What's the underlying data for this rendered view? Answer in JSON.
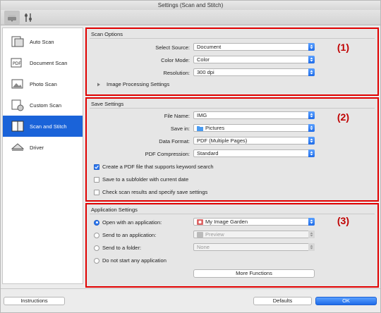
{
  "window": {
    "title": "Settings (Scan and Stitch)"
  },
  "toolbar": {
    "tabs": [
      {
        "icon": "scanner-settings-icon"
      },
      {
        "icon": "general-settings-icon"
      }
    ]
  },
  "sidebar": {
    "items": [
      {
        "label": "Auto Scan",
        "icon": "auto-scan-icon"
      },
      {
        "label": "Document Scan",
        "icon": "document-scan-icon"
      },
      {
        "label": "Photo Scan",
        "icon": "photo-scan-icon"
      },
      {
        "label": "Custom Scan",
        "icon": "custom-scan-icon"
      },
      {
        "label": "Scan and Stitch",
        "icon": "scan-and-stitch-icon",
        "selected": true
      },
      {
        "label": "Driver",
        "icon": "driver-icon"
      }
    ]
  },
  "scan_options": {
    "heading": "Scan Options",
    "callout": "(1)",
    "select_source": {
      "label": "Select Source:",
      "value": "Document"
    },
    "color_mode": {
      "label": "Color Mode:",
      "value": "Color"
    },
    "resolution": {
      "label": "Resolution:",
      "value": "300 dpi"
    },
    "image_processing": "Image Processing Settings"
  },
  "save_settings": {
    "heading": "Save Settings",
    "callout": "(2)",
    "file_name": {
      "label": "File Name:",
      "value": "IMG"
    },
    "save_in": {
      "label": "Save in:",
      "value": "Pictures"
    },
    "data_format": {
      "label": "Data Format:",
      "value": "PDF (Multiple Pages)"
    },
    "pdf_compression": {
      "label": "PDF Compression:",
      "value": "Standard"
    },
    "checks": [
      {
        "label": "Create a PDF file that supports keyword search",
        "checked": true
      },
      {
        "label": "Save to a subfolder with current date",
        "checked": false
      },
      {
        "label": "Check scan results and specify save settings",
        "checked": false
      }
    ]
  },
  "app_settings": {
    "heading": "Application Settings",
    "callout": "(3)",
    "options": [
      {
        "label": "Open with an application:",
        "value": "My Image Garden",
        "checked": true,
        "enabled": true
      },
      {
        "label": "Send to an application:",
        "value": "Preview",
        "checked": false,
        "enabled": false
      },
      {
        "label": "Send to a folder:",
        "value": "None",
        "checked": false,
        "enabled": false
      },
      {
        "label": "Do not start any application",
        "checked": false
      }
    ],
    "more_functions": "More Functions"
  },
  "footer": {
    "instructions": "Instructions",
    "defaults": "Defaults",
    "ok": "OK"
  },
  "colors": {
    "accent": "#1a63d9",
    "callout_red": "#e00000"
  }
}
